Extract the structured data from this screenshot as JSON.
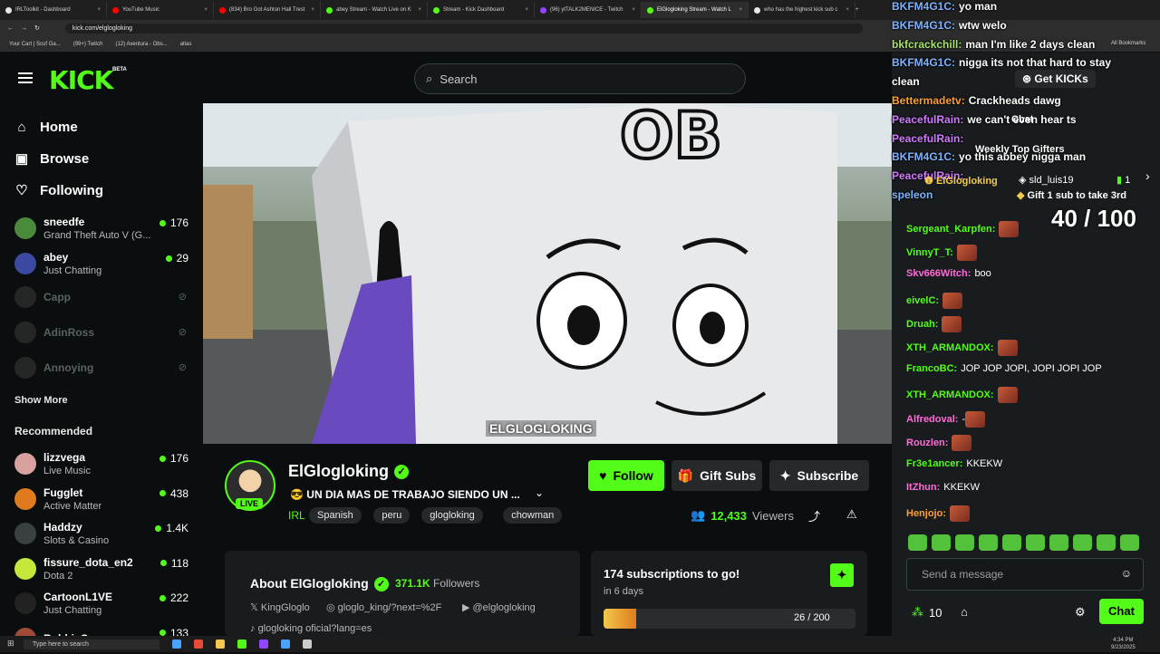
{
  "browser": {
    "tabs": [
      {
        "title": "IRLToolkit - Dashboard",
        "color": "#e8e8e8"
      },
      {
        "title": "YouTube Music",
        "color": "#ff0000"
      },
      {
        "title": "(834) Bro Got Ashton Hall Trest",
        "color": "#ff0000"
      },
      {
        "title": "abey Stream - Watch Live on K",
        "color": "#53fc18"
      },
      {
        "title": "Stream - Kick Dashboard",
        "color": "#53fc18"
      },
      {
        "title": "(96) ytTALK2MENICE - Twitch",
        "color": "#9146ff"
      },
      {
        "title": "ElGlogloking Stream - Watch L",
        "color": "#53fc18"
      },
      {
        "title": "who has the highest kick sub c",
        "color": "#e8e8e8"
      }
    ],
    "url": "kick.com/elglogloking",
    "bookmarks": [
      "Your Cart | Scuf Ga...",
      "(99+) Twitch",
      "(12) Aventura - Obs...",
      "atlas"
    ],
    "all_bookmarks": "All Bookmarks"
  },
  "header": {
    "logo": "KICK",
    "beta": "BETA",
    "search_placeholder": "Search"
  },
  "sidebar": {
    "nav": [
      {
        "label": "Home",
        "icon": "home-icon"
      },
      {
        "label": "Browse",
        "icon": "browse-icon"
      },
      {
        "label": "Following",
        "icon": "heart-icon"
      }
    ],
    "following": [
      {
        "name": "sneedfe",
        "category": "Grand Theft Auto V (G...",
        "viewers": "176",
        "color": "#4b8a3c"
      },
      {
        "name": "abey",
        "category": "Just Chatting",
        "viewers": "29",
        "color": "#3b4aa0"
      }
    ],
    "offline": [
      {
        "name": "Capp"
      },
      {
        "name": "AdinRoss"
      },
      {
        "name": "Annoying"
      }
    ],
    "show_more": "Show More",
    "recommended_title": "Recommended",
    "recommended": [
      {
        "name": "lizzvega",
        "category": "Live Music",
        "viewers": "176",
        "color": "#d9a0a0"
      },
      {
        "name": "Fugglet",
        "category": "Active Matter",
        "viewers": "438",
        "color": "#e07a1f"
      },
      {
        "name": "Haddzy",
        "category": "Slots & Casino",
        "viewers": "1.4K",
        "color": "#3a3f42"
      },
      {
        "name": "fissure_dota_en2",
        "category": "Dota 2",
        "viewers": "118",
        "color": "#c6e83a"
      },
      {
        "name": "CartoonL1VE",
        "category": "Just Chatting",
        "viewers": "222",
        "color": "#222222"
      },
      {
        "name": "RobbieCrow",
        "category": "",
        "viewers": "133",
        "color": "#a04a3a"
      }
    ]
  },
  "video": {
    "caption": "ELGLOGLOKING"
  },
  "stream": {
    "name": "ElGlogloking",
    "live": "LIVE",
    "title": "😎 UN DIA MAS DE TRABAJO SIENDO UN ...",
    "category": "IRL",
    "tags": [
      "Spanish",
      "peru",
      "glogloking",
      "chowman"
    ],
    "follow": "Follow",
    "gift_subs": "Gift Subs",
    "subscribe": "Subscribe",
    "viewers": "12,433",
    "viewers_label": "Viewers"
  },
  "about": {
    "title": "About ElGlogloking",
    "followers": "371.1K",
    "followers_label": "Followers",
    "socials": [
      "KingGloglo",
      "gloglo_king/?next=%2F",
      "@elglogloking",
      "glogloking oficial?lang=es"
    ]
  },
  "subgoal": {
    "title": "174 subscriptions to go!",
    "time": "in 6 days",
    "count": "26 / 200",
    "progress": 0.13
  },
  "overlay_chat": [
    {
      "user": "BKFM4G1C:",
      "text": "yo man",
      "color": "#7fb3ff"
    },
    {
      "user": "BKFM4G1C:",
      "text": "wtw welo",
      "color": "#7fb3ff"
    },
    {
      "user": "bkfcrackchill:",
      "text": "man I'm like 2 days clean",
      "color": "#a6e36a"
    },
    {
      "user": "BKFM4G1C:",
      "text": "nigga its not that hard to stay",
      "color": "#7fb3ff"
    },
    {
      "user": "",
      "text": "clean",
      "color": "#ffffff"
    },
    {
      "user": "Bettermadetv:",
      "text": "Crackheads dawg",
      "color": "#ff9f2e"
    },
    {
      "user": "PeacefulRain:",
      "text": "we can't even hear ts",
      "color": "#d07bff"
    },
    {
      "user": "PeacefulRain:",
      "text": "",
      "color": "#d07bff"
    },
    {
      "user": "BKFM4G1C:",
      "text": "yo this abbey nigga man",
      "color": "#7fb3ff"
    },
    {
      "user": "PeacefulRain:",
      "text": "",
      "color": "#d07bff"
    },
    {
      "user": "speleon",
      "text": "",
      "color": "#7fb3ff"
    }
  ],
  "chat_panel": {
    "get_kicks": "Get KICKs",
    "chat_label": "Chat",
    "weekly_top": "Weekly Top Gifters",
    "top_gifter_1": "ElGlogloking",
    "top_gifter_2": "sld_luis19",
    "top_gifter_2_count": "1",
    "gift_prompt": "Gift 1 sub to take 3rd",
    "counter": "40 / 100",
    "messages": [
      {
        "user": "Sergeant_Karpfen:",
        "text": "",
        "color": "#53fc18",
        "emote": true
      },
      {
        "user": "VinnyT_T:",
        "text": "",
        "color": "#53fc18",
        "emote": true
      },
      {
        "user": "Skv666Witch:",
        "text": "boo",
        "color": "#ff6bd6",
        "emote": false
      },
      {
        "user": "eivelC:",
        "text": "",
        "color": "#53fc18",
        "emote": true
      },
      {
        "user": "Druah:",
        "text": "",
        "color": "#53fc18",
        "emote": true
      },
      {
        "user": "XTH_ARMANDOX:",
        "text": "",
        "color": "#53fc18",
        "emote": true
      },
      {
        "user": "FrancoBC:",
        "text": "JOP JOP JOPI, JOPI JOPI JOP",
        "color": "#53fc18",
        "emote": false
      },
      {
        "user": "XTH_ARMANDOX:",
        "text": "",
        "color": "#53fc18",
        "emote": true
      },
      {
        "user": "Alfredoval:",
        "text": "-",
        "color": "#ff6bd6",
        "emote": true
      },
      {
        "user": "Rouzlen:",
        "text": "",
        "color": "#ff6bd6",
        "emote": true
      },
      {
        "user": "Fr3e1ancer:",
        "text": "KKEKW",
        "color": "#53fc18",
        "emote": false
      },
      {
        "user": "ItZhun:",
        "text": "KKEKW",
        "color": "#ff6bd6",
        "emote": false
      },
      {
        "user": "Henjojo:",
        "text": "",
        "color": "#ff9f2e",
        "emote": true
      }
    ],
    "input_placeholder": "Send a message",
    "kicks_count": "10",
    "send": "Chat"
  },
  "taskbar": {
    "search": "Type here to search",
    "time": "4:34 PM",
    "date": "9/23/2025"
  }
}
